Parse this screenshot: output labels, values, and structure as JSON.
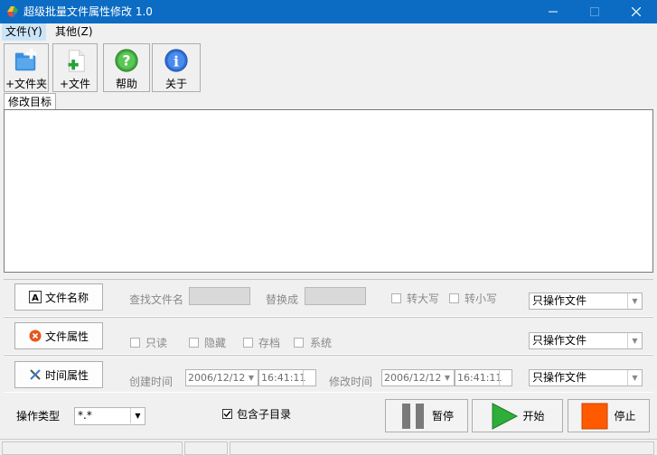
{
  "window": {
    "title": "超级批量文件属性修改 1.0",
    "controls": {
      "minimize": "minimize-icon",
      "maximize": "maximize-icon",
      "close": "close-icon"
    }
  },
  "menu": [
    {
      "label": "文件(Y)"
    },
    {
      "label": "其他(Z)"
    }
  ],
  "toolbar": [
    {
      "label": "+文件夹",
      "icon": "add-folder-icon"
    },
    {
      "label": "+文件",
      "icon": "add-file-icon"
    },
    {
      "label": "帮助",
      "icon": "help-icon"
    },
    {
      "label": "关于",
      "icon": "info-icon"
    }
  ],
  "tab": {
    "label": "修改目标"
  },
  "filename_section": {
    "button": "文件名称",
    "find_label": "查找文件名",
    "find_value": "",
    "replace_label": "替换成",
    "replace_value": "",
    "upper": "转大写",
    "lower": "转小写",
    "scope": "只操作文件"
  },
  "attr_section": {
    "button": "文件属性",
    "readonly": "只读",
    "hidden": "隐藏",
    "archive": "存档",
    "system": "系统",
    "scope": "只操作文件"
  },
  "time_section": {
    "button": "时间属性",
    "created_label": "创建时间",
    "created_date": "2006/12/12",
    "created_time": "16:41:11",
    "modified_label": "修改时间",
    "modified_date": "2006/12/12",
    "modified_time": "16:41:11",
    "scope": "只操作文件"
  },
  "bottom": {
    "op_type_label": "操作类型",
    "op_type_value": "*.*",
    "include_subdirs": "包含子目录",
    "pause": "暂停",
    "start": "开始",
    "stop": "停止"
  },
  "colors": {
    "titlebar": "#0c6cc4",
    "start_green": "#2fae3a",
    "stop_orange": "#ff5a00"
  }
}
